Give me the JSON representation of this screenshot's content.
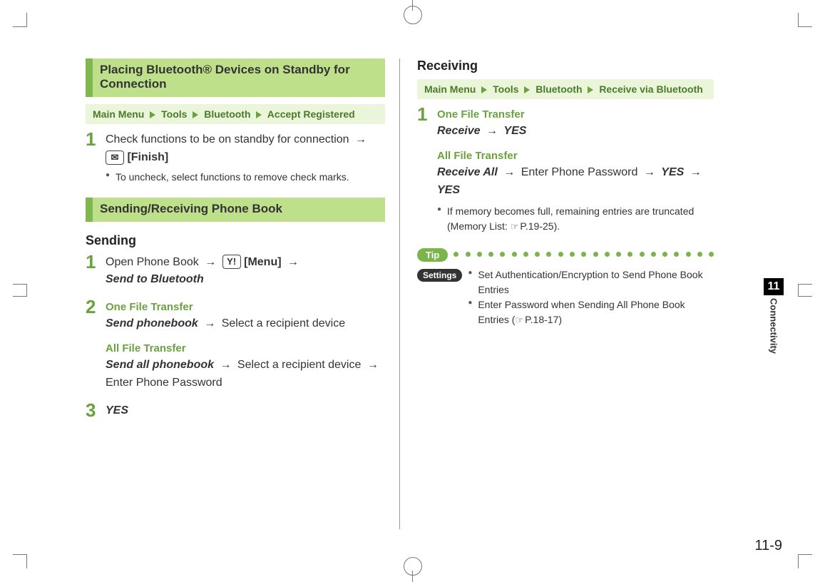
{
  "page_number": "11-9",
  "side_tab": {
    "number": "11",
    "label": "Connectivity"
  },
  "left": {
    "band_title": "Placing Bluetooth® Devices on Standby for Connection",
    "breadcrumb": {
      "root": "Main Menu",
      "items": [
        "Tools",
        "Bluetooth",
        "Accept Registered"
      ]
    },
    "step1_text": "Check functions to be on standby for connection",
    "step1_key_glyph": "✉",
    "step1_key_label": "[Finish]",
    "step1_note": "To uncheck, select functions to remove check marks.",
    "band2_title": "Sending/Receiving Phone Book",
    "sending_label": "Sending",
    "s_step1_prefix": "Open Phone Book",
    "s_step1_key_glyph": "Y!",
    "s_step1_key_label": "[Menu]",
    "s_step1_line2": "Send to Bluetooth",
    "s_step2_title": "One File Transfer",
    "s_step2_cmd": "Send phonebook",
    "s_step2_rest": "Select a recipient device",
    "s_step2b_title": "All File Transfer",
    "s_step2b_cmd": "Send all phonebook",
    "s_step2b_rest1": "Select a recipient device",
    "s_step2b_rest2": "Enter Phone Password",
    "s_step3": "YES"
  },
  "right": {
    "receiving_label": "Receiving",
    "breadcrumb": {
      "root": "Main Menu",
      "items": [
        "Tools",
        "Bluetooth",
        "Receive via Bluetooth"
      ]
    },
    "r_step1_title": "One File Transfer",
    "r_step1_cmd": "Receive",
    "r_step1_rest": "YES",
    "r_step1b_title": "All File Transfer",
    "r_step1b_cmd": "Receive All",
    "r_step1b_mid": "Enter Phone Password",
    "r_step1b_yes1": "YES",
    "r_step1b_yes2": "YES",
    "r_note_prefix": "If memory becomes full, remaining entries are truncated (Memory List: ",
    "r_note_ref": "P.19-25",
    "r_note_suffix": ").",
    "tip_label": "Tip",
    "settings_label": "Settings",
    "settings_line1": "Set Authentication/Encryption to Send Phone Book Entries",
    "settings_line2_prefix": "Enter Password when Sending All Phone Book Entries (",
    "settings_line2_ref": "P.18-17",
    "settings_line2_suffix": ")"
  },
  "glyphs": {
    "arrow": "→",
    "hand": "☞"
  }
}
